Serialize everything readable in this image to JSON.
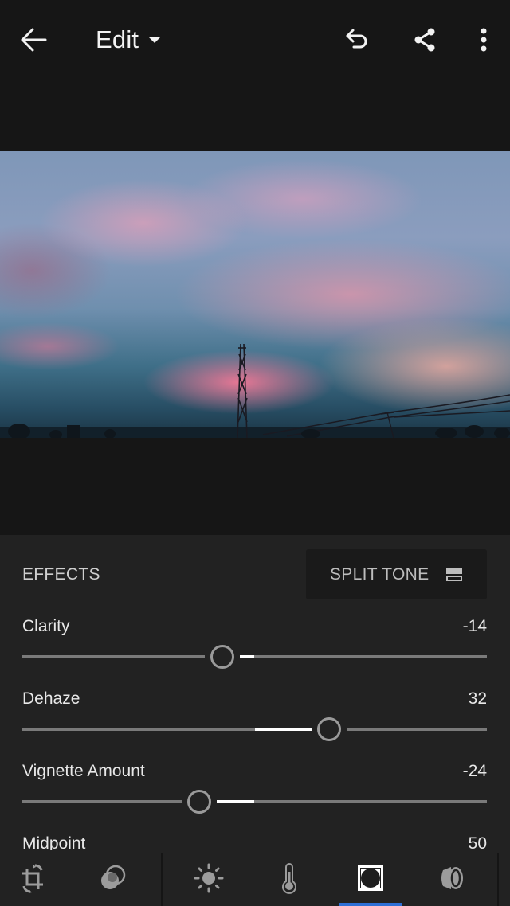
{
  "header": {
    "title": "Edit",
    "icons": [
      "back-arrow-icon",
      "dropdown-caret-icon",
      "undo-icon",
      "share-icon",
      "more-vertical-icon"
    ]
  },
  "photo": {
    "description": "Sunset sky with pink clouds, a transmission tower and power lines"
  },
  "panel": {
    "section_title": "EFFECTS",
    "split_tone_label": "SPLIT TONE",
    "sliders": [
      {
        "label": "Clarity",
        "value": "-14",
        "numeric": -14,
        "min": -100,
        "max": 100
      },
      {
        "label": "Dehaze",
        "value": "32",
        "numeric": 32,
        "min": -100,
        "max": 100
      },
      {
        "label": "Vignette Amount",
        "value": "-24",
        "numeric": -24,
        "min": -100,
        "max": 100
      },
      {
        "label": "Midpoint",
        "value": "50",
        "numeric": 50,
        "min": 0,
        "max": 100
      }
    ]
  },
  "toolbar": {
    "tools": [
      {
        "name": "crop",
        "icon": "crop-rotate-icon"
      },
      {
        "name": "presets",
        "icon": "presets-icon"
      },
      {
        "name": "light",
        "icon": "light-sun-icon"
      },
      {
        "name": "color",
        "icon": "thermometer-icon"
      },
      {
        "name": "effects",
        "icon": "vignette-icon",
        "active": true
      },
      {
        "name": "detail",
        "icon": "lens-icon"
      }
    ],
    "active_tool": "effects",
    "accent_color": "#2d6fd6"
  }
}
